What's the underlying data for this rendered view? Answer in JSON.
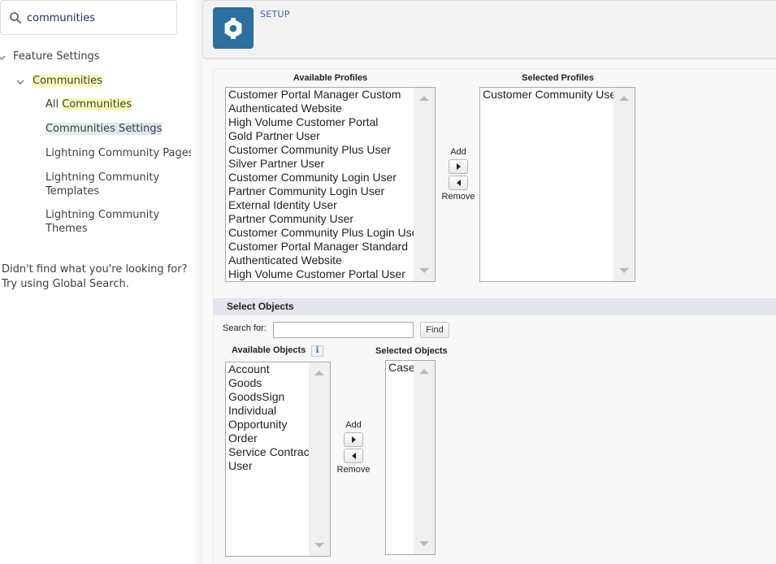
{
  "sidebar": {
    "search": {
      "value": "communities",
      "icon": "search-icon"
    },
    "tree": {
      "feature_settings": "Feature Settings",
      "communities": "Communities",
      "items": [
        {
          "prefix": "All ",
          "highlight": "Communities"
        },
        {
          "label": "Communities Settings"
        },
        {
          "label": "Lightning Community Pages"
        },
        {
          "label_line1": "Lightning Community",
          "label_line2": "Templates"
        },
        {
          "label_line1": "Lightning Community",
          "label_line2": "Themes"
        }
      ]
    },
    "footer": {
      "line1": "Didn't find what you're looking for?",
      "line2": "Try using Global Search."
    }
  },
  "header": {
    "icon": "gear-icon",
    "label": "SETUP",
    "icon_color": "#2a6fa0"
  },
  "profiles": {
    "available_heading": "Available Profiles",
    "selected_heading": "Selected Profiles",
    "available": [
      "Customer Portal Manager Custom",
      "Authenticated Website",
      "High Volume Customer Portal",
      "Gold Partner User",
      "Customer Community Plus User",
      "Silver Partner User",
      "Customer Community Login User",
      "Partner Community Login User",
      "External Identity User",
      "Partner Community User",
      "Customer Community Plus Login User",
      "Customer Portal Manager Standard",
      "Authenticated Website",
      "High Volume Customer Portal User"
    ],
    "selected": [
      "Customer Community User"
    ],
    "add_label": "Add",
    "remove_label": "Remove"
  },
  "objects": {
    "section_title": "Select Objects",
    "search_label": "Search  for:",
    "search_value": "",
    "find_label": "Find",
    "available_heading": "Available Objects",
    "info_icon": "i",
    "selected_heading": "Selected Objects",
    "available": [
      "Account",
      "Goods",
      "GoodsSign",
      "Individual",
      "Opportunity",
      "Order",
      "Service Contract",
      "User"
    ],
    "selected": [
      "Case"
    ],
    "add_label": "Add",
    "remove_label": "Remove"
  }
}
